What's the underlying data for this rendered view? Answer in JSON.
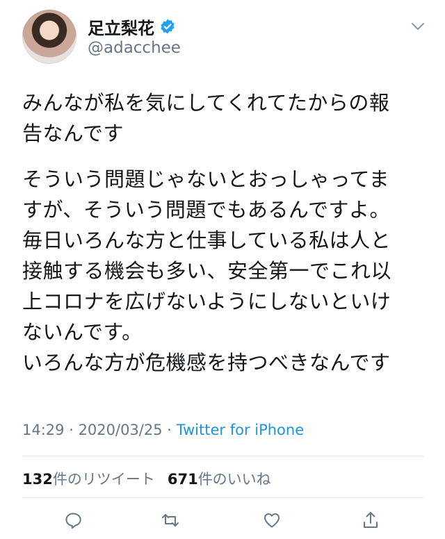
{
  "author": {
    "display_name": "足立梨花",
    "handle": "@adacchee",
    "verified": true
  },
  "tweet": {
    "paragraph1": "みんなが私を気にしてくれてたからの報\n告なんです",
    "paragraph2": "そういう問題じゃないとおっしゃってま\nすが、そういう問題でもあるんですよ。\n毎日いろんな方と仕事している私は人と\n接触する機会も多い、安全第一でこれ以\n上コロナを広げないようにしないといけ\nないんです。\nいろんな方が危機感を持つべきなんです"
  },
  "meta": {
    "time": "14:29",
    "separator1": " · ",
    "date": "2020/03/25",
    "separator2": " · ",
    "source": "Twitter for iPhone"
  },
  "stats": {
    "retweets_count": "132",
    "retweets_label": "件のリツイート",
    "likes_count": "671",
    "likes_label": "件のいいね"
  },
  "icons": {
    "verified": "verified-badge-icon",
    "caret": "chevron-down-icon",
    "reply": "reply-icon",
    "retweet": "retweet-icon",
    "like": "heart-icon",
    "share": "share-icon"
  },
  "colors": {
    "text": "#14171a",
    "secondary": "#657786",
    "link": "#1b95e0",
    "verified": "#1da1f2",
    "divider": "#e1e8ed"
  }
}
